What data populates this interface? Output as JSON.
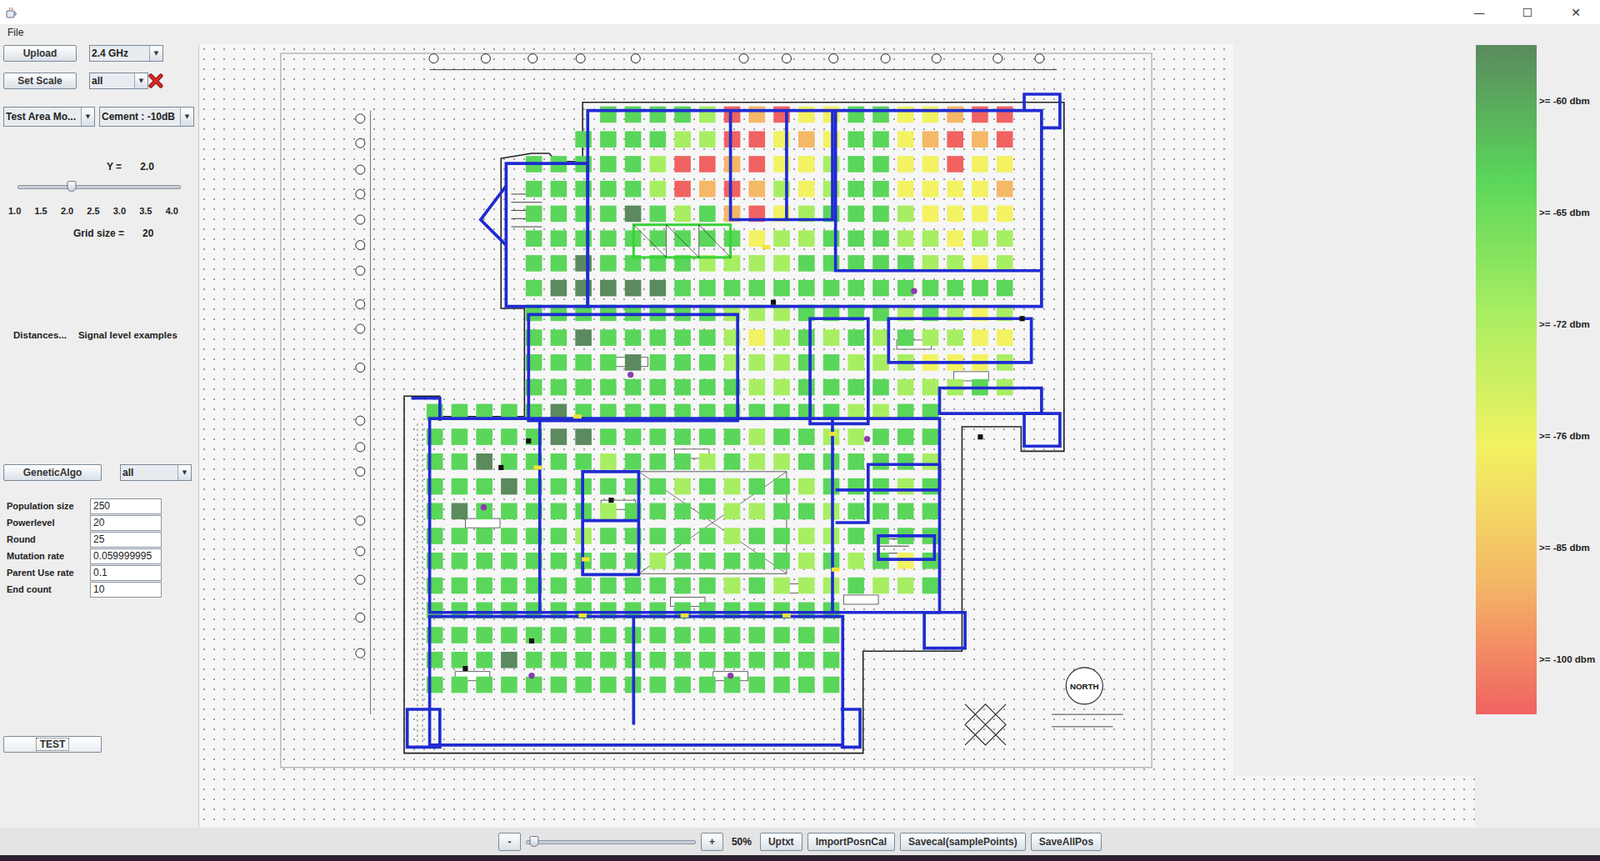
{
  "window": {
    "controls": [
      "—",
      "☐",
      "✕"
    ]
  },
  "menu": [
    "File"
  ],
  "sidebar": {
    "upload_button": "Upload",
    "band": {
      "value": "2.4 GHz"
    },
    "scale_button": "Set Scale",
    "scale_filter": {
      "value": "all"
    },
    "combo_arrow": "▼",
    "mode": {
      "value": "Test Area Mo..."
    },
    "material": {
      "value": "Cement : -10dB"
    },
    "y_label": "Y =",
    "y_value": "2.0",
    "y_slider": {
      "level": 0.333,
      "ticks": [
        "1.0",
        "1.5",
        "2.0",
        "2.5",
        "3.0",
        "3.5",
        "4.0"
      ]
    },
    "grid_label": "Grid size =",
    "grid_value": "20",
    "links": [
      "Distances...",
      "Signal level examples"
    ],
    "ga_button": "GeneticAlgo",
    "ga_filter": {
      "value": "all"
    },
    "params": [
      {
        "label": "Population size",
        "value": "250"
      },
      {
        "label": "Powerlevel",
        "value": "20"
      },
      {
        "label": "Round",
        "value": "25"
      },
      {
        "label": "Mutation rate",
        "value": "0.059999995"
      },
      {
        "label": "Parent Use rate",
        "value": "0.1"
      },
      {
        "label": "End count",
        "value": "10"
      }
    ],
    "test_button": "TEST"
  },
  "legend": [
    {
      "label": ">= -60 dbm",
      "value": -60,
      "color": "#5a8a5e"
    },
    {
      "label": ">= -65 dbm",
      "value": -65,
      "color": "#5ad65a"
    },
    {
      "label": ">= -72 dbm",
      "value": -72,
      "color": "#a8ee62"
    },
    {
      "label": ">= -76 dbm",
      "value": -76,
      "color": "#f2f262"
    },
    {
      "label": ">= -85 dbm",
      "value": -85,
      "color": "#f4b866"
    },
    {
      "label": ">= -100 dbm",
      "value": -100,
      "color": "#f06262"
    }
  ],
  "plan": {
    "north_label": "NORTH",
    "heatmap": {
      "rows": [
        [
          null,
          null,
          null,
          null,
          null,
          null,
          null,
          -63,
          -63,
          -63,
          -63,
          -70,
          -92,
          -80,
          -92,
          -74,
          -74,
          -63,
          -63,
          -74,
          -74,
          -80,
          -92,
          -92
        ],
        [
          null,
          null,
          null,
          null,
          null,
          null,
          -63,
          -63,
          -63,
          -63,
          -70,
          -70,
          -92,
          -92,
          -74,
          -80,
          -74,
          -63,
          -63,
          -74,
          -80,
          -92,
          -80,
          -92
        ],
        [
          null,
          null,
          null,
          null,
          -63,
          -63,
          -63,
          -63,
          -63,
          -70,
          -92,
          -92,
          -80,
          -92,
          -74,
          -74,
          -70,
          -63,
          -63,
          -74,
          -74,
          -92,
          -74,
          -74
        ],
        [
          null,
          null,
          null,
          null,
          -63,
          -63,
          -63,
          -63,
          -63,
          -70,
          -92,
          -80,
          -92,
          -80,
          -70,
          -74,
          -70,
          -63,
          -63,
          -74,
          -74,
          -74,
          -74,
          -80
        ],
        [
          null,
          null,
          null,
          null,
          -63,
          -63,
          -63,
          -63,
          -58,
          -63,
          -70,
          -63,
          -80,
          -92,
          -74,
          -70,
          -63,
          -63,
          -63,
          -70,
          -74,
          -74,
          -74,
          -74
        ],
        [
          null,
          null,
          null,
          null,
          -63,
          -63,
          -63,
          -63,
          -63,
          -63,
          -63,
          -63,
          -63,
          -74,
          -70,
          -70,
          -63,
          -63,
          -63,
          -70,
          -70,
          -74,
          -70,
          -70
        ],
        [
          null,
          null,
          null,
          null,
          -63,
          -63,
          -58,
          -63,
          -63,
          -63,
          -63,
          -70,
          -70,
          -70,
          -70,
          -63,
          -63,
          -63,
          -63,
          -63,
          -70,
          -70,
          -74,
          -70
        ],
        [
          null,
          null,
          null,
          null,
          -63,
          -58,
          -58,
          -58,
          -58,
          -58,
          -63,
          -63,
          -63,
          -63,
          -63,
          -63,
          -63,
          -63,
          -63,
          -63,
          -63,
          -63,
          -63,
          -63
        ],
        [
          null,
          null,
          null,
          null,
          -63,
          -63,
          -63,
          -63,
          -63,
          -63,
          -63,
          -63,
          -70,
          -70,
          -70,
          -63,
          -63,
          -63,
          -63,
          -70,
          -63,
          -70,
          -74,
          -70
        ],
        [
          null,
          null,
          null,
          null,
          -63,
          -63,
          -58,
          -63,
          -63,
          -63,
          -63,
          -63,
          -70,
          -74,
          -70,
          -63,
          -70,
          -63,
          -70,
          -63,
          -70,
          -70,
          -74,
          -74
        ],
        [
          null,
          null,
          null,
          null,
          -63,
          -63,
          -63,
          -63,
          -58,
          -63,
          -63,
          -63,
          -70,
          -70,
          -70,
          -63,
          -63,
          -70,
          -70,
          -70,
          -74,
          -74,
          -74,
          -70
        ],
        [
          null,
          null,
          null,
          null,
          -63,
          -63,
          -63,
          -63,
          -63,
          -63,
          -63,
          -63,
          -63,
          -70,
          -70,
          -63,
          -63,
          -63,
          -63,
          -70,
          -70,
          -70,
          -63,
          -70
        ],
        [
          -63,
          -63,
          -63,
          -63,
          -63,
          -58,
          -63,
          -63,
          -63,
          -63,
          -63,
          -63,
          -63,
          -63,
          -63,
          -63,
          -63,
          -70,
          -70,
          -63,
          -63,
          null,
          null,
          null
        ],
        [
          -63,
          -63,
          -63,
          -63,
          -63,
          -58,
          -58,
          -63,
          -63,
          -63,
          -63,
          -63,
          -63,
          -70,
          -63,
          -63,
          -70,
          -70,
          -63,
          -63,
          -63,
          null,
          null,
          null
        ],
        [
          -63,
          -63,
          -58,
          -63,
          -63,
          -63,
          -63,
          -70,
          -63,
          -63,
          -63,
          -70,
          -63,
          -70,
          -70,
          -63,
          -63,
          -63,
          -63,
          -63,
          -70,
          null,
          null,
          null
        ],
        [
          -63,
          -63,
          -63,
          -58,
          -63,
          -63,
          -63,
          -63,
          -63,
          -63,
          -70,
          -63,
          -70,
          -63,
          -63,
          -70,
          -63,
          -63,
          -63,
          -70,
          -63,
          null,
          null,
          null
        ],
        [
          -63,
          -58,
          -63,
          -63,
          -63,
          -63,
          -63,
          -70,
          -63,
          -63,
          -63,
          -63,
          -70,
          -70,
          -63,
          -63,
          -70,
          -63,
          -63,
          -63,
          -63,
          null,
          null,
          null
        ],
        [
          -63,
          -63,
          -63,
          -63,
          -63,
          -63,
          -70,
          -63,
          -63,
          -63,
          -63,
          -63,
          -70,
          -63,
          -63,
          -70,
          -70,
          -63,
          -63,
          -63,
          -63,
          null,
          null,
          null
        ],
        [
          -63,
          -63,
          -63,
          -63,
          -63,
          -63,
          -63,
          -63,
          -63,
          -70,
          -63,
          -63,
          -63,
          -63,
          -63,
          -70,
          -63,
          -70,
          -63,
          -74,
          -63,
          null,
          null,
          null
        ],
        [
          -63,
          -63,
          -63,
          -63,
          -63,
          -63,
          -63,
          -63,
          -63,
          -63,
          -63,
          -63,
          -70,
          -63,
          -70,
          -70,
          -70,
          -63,
          -70,
          -70,
          -63,
          null,
          null,
          null
        ],
        [
          -63,
          -63,
          -63,
          -63,
          -63,
          -63,
          -63,
          -63,
          -63,
          -63,
          -63,
          -63,
          -63,
          -63,
          -63,
          -63,
          -63,
          null,
          null,
          null,
          null,
          null,
          null,
          null
        ],
        [
          -63,
          -63,
          -63,
          -63,
          -63,
          -63,
          -63,
          -63,
          -63,
          -63,
          -63,
          -63,
          -63,
          -63,
          -63,
          -63,
          -63,
          null,
          null,
          null,
          null,
          null,
          null,
          null
        ],
        [
          -63,
          -63,
          -63,
          -58,
          -63,
          -63,
          -63,
          -63,
          -63,
          -63,
          -63,
          -63,
          -63,
          -63,
          -63,
          -63,
          -63,
          null,
          null,
          null,
          null,
          null,
          null,
          null
        ],
        [
          -63,
          -63,
          -63,
          -63,
          -63,
          -63,
          -63,
          -63,
          -63,
          -63,
          -63,
          -63,
          -63,
          -63,
          -63,
          -63,
          -63,
          null,
          null,
          null,
          null,
          null,
          null,
          null
        ]
      ]
    }
  },
  "toolbar": {
    "zoom_out": "-",
    "zoom_slider": {
      "level": 0.05
    },
    "zoom_in": "+",
    "zoom_label": "50%",
    "buttons": [
      "Uptxt",
      "ImportPosnCal",
      "Savecal(samplePoints)",
      "SaveAllPos"
    ]
  }
}
